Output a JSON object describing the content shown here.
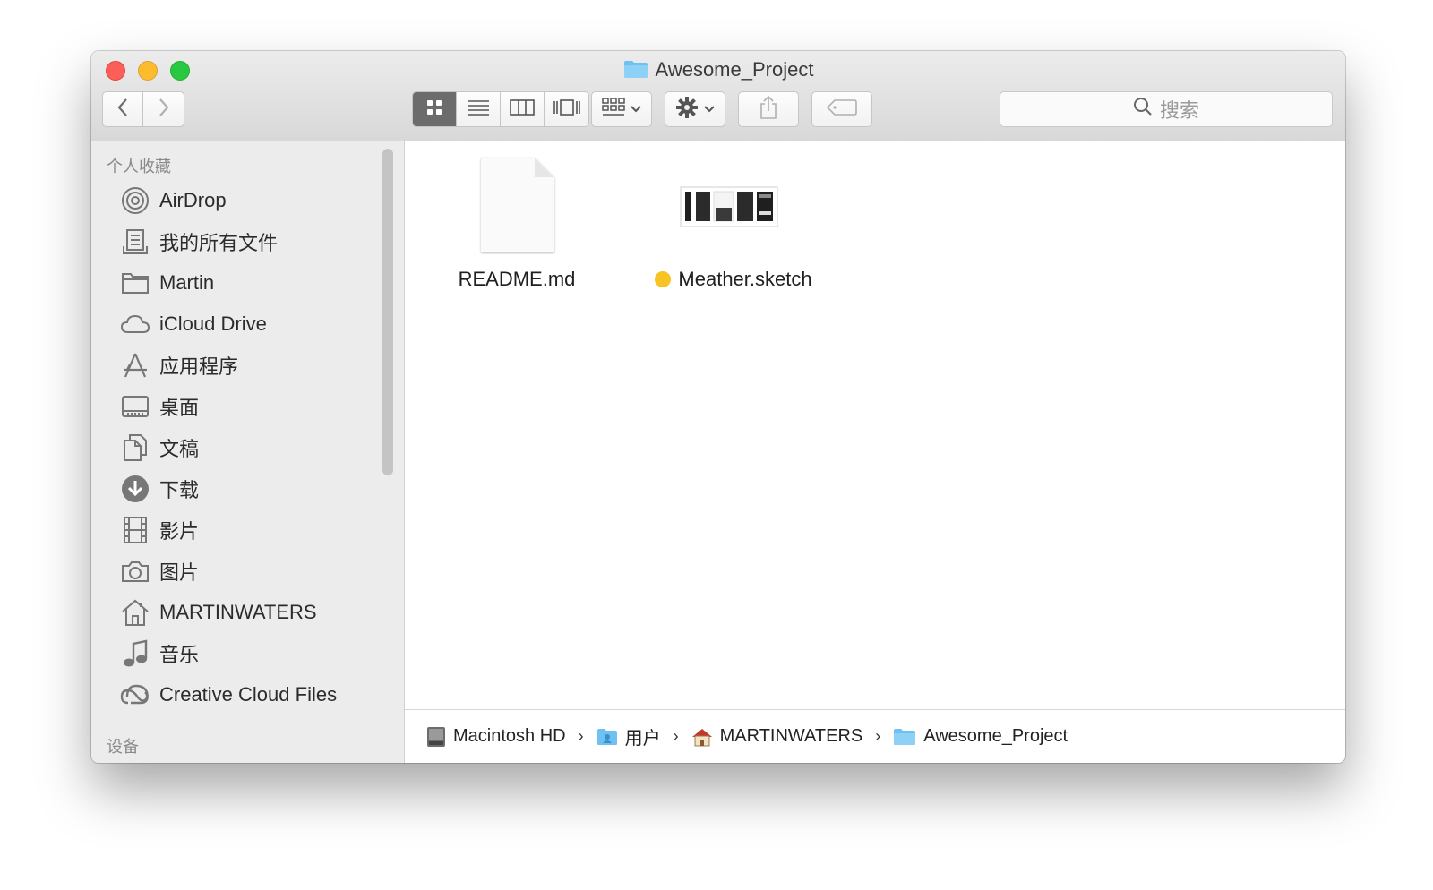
{
  "window": {
    "title": "Awesome_Project"
  },
  "toolbar": {
    "back_icon": "chevron-left-icon",
    "forward_icon": "chevron-right-icon",
    "view_modes": [
      "icon-view",
      "list-view",
      "column-view",
      "cover-flow-view"
    ],
    "active_view": "icon-view",
    "search_placeholder": "搜索"
  },
  "sidebar": {
    "favorites_header": "个人收藏",
    "items": [
      {
        "label": "AirDrop",
        "icon": "airdrop-icon"
      },
      {
        "label": "我的所有文件",
        "icon": "all-files-icon"
      },
      {
        "label": "Martin",
        "icon": "folder-icon"
      },
      {
        "label": "iCloud Drive",
        "icon": "cloud-icon"
      },
      {
        "label": "应用程序",
        "icon": "applications-icon"
      },
      {
        "label": "桌面",
        "icon": "desktop-icon"
      },
      {
        "label": "文稿",
        "icon": "documents-icon"
      },
      {
        "label": "下载",
        "icon": "download-icon"
      },
      {
        "label": "影片",
        "icon": "movies-icon"
      },
      {
        "label": "图片",
        "icon": "camera-icon"
      },
      {
        "label": "MARTINWATERS",
        "icon": "home-icon"
      },
      {
        "label": "音乐",
        "icon": "music-icon"
      },
      {
        "label": "Creative Cloud Files",
        "icon": "creative-cloud-icon"
      }
    ],
    "devices_header": "设备"
  },
  "files": [
    {
      "name": "README.md",
      "icon": "document-icon"
    },
    {
      "name": "Meather.sketch",
      "icon": "sketch-thumbnail-icon",
      "tag_color": "#f7c325"
    }
  ],
  "pathbar": {
    "crumbs": [
      {
        "label": "Macintosh HD",
        "icon": "hard-drive-icon"
      },
      {
        "label": "用户",
        "icon": "users-folder-icon"
      },
      {
        "label": "MARTINWATERS",
        "icon": "home-icon"
      },
      {
        "label": "Awesome_Project",
        "icon": "folder-icon"
      }
    ],
    "separator": "›"
  },
  "colors": {
    "close": "#fc5f57",
    "minimize": "#fdbc2e",
    "maximize": "#28c840",
    "folder_blue": "#6fc1f1",
    "tag_yellow": "#f7c325"
  }
}
